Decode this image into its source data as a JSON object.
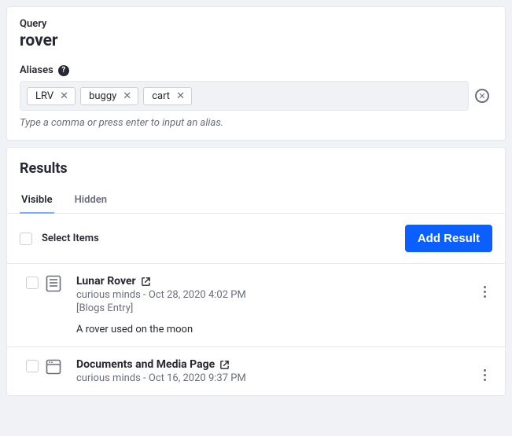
{
  "query": {
    "label": "Query",
    "value": "rover",
    "aliases_label": "Aliases",
    "aliases": [
      "LRV",
      "buggy",
      "cart"
    ],
    "hint": "Type a comma or press enter to input an alias."
  },
  "results": {
    "title": "Results",
    "tabs": {
      "visible": "Visible",
      "hidden": "Hidden"
    },
    "select_items_label": "Select Items",
    "add_button_label": "Add Result",
    "items": [
      {
        "title": "Lunar Rover",
        "meta": "curious minds - Oct 28, 2020 4:02 PM",
        "tag": "[Blogs Entry]",
        "desc": "A rover used on the moon"
      },
      {
        "title": "Documents and Media Page",
        "meta": "curious minds - Oct 16, 2020 9:37 PM",
        "tag": "",
        "desc": ""
      }
    ]
  }
}
